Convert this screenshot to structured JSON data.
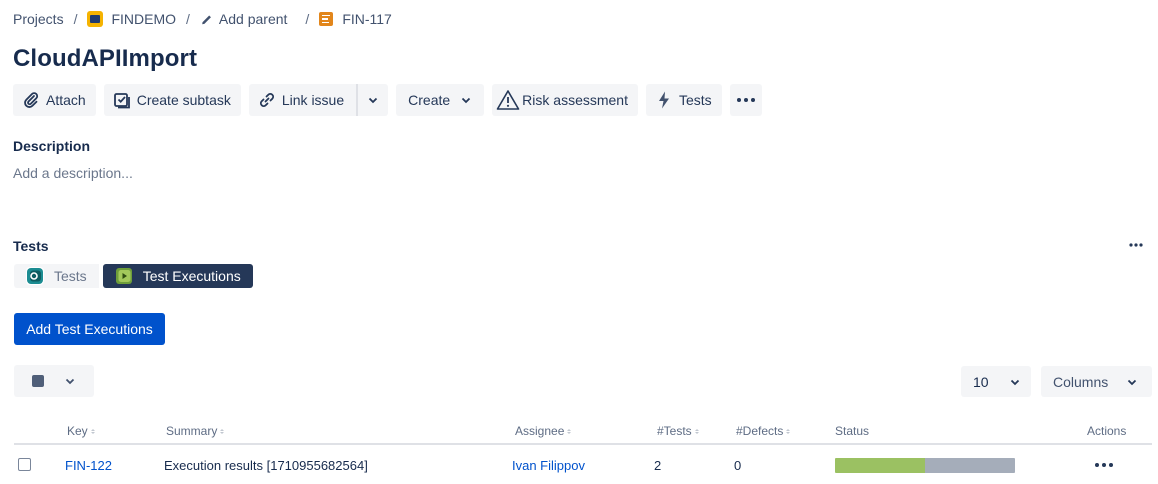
{
  "breadcrumb": {
    "projects": "Projects",
    "project": "FINDEMO",
    "add_parent": "Add parent",
    "issue_key": "FIN-117"
  },
  "issue": {
    "title": "CloudAPIImport"
  },
  "toolbar": {
    "attach": "Attach",
    "create_subtask": "Create subtask",
    "link_issue": "Link issue",
    "create": "Create",
    "risk_assessment": "Risk assessment",
    "tests": "Tests"
  },
  "description": {
    "label": "Description",
    "placeholder": "Add a description..."
  },
  "tests_panel": {
    "label": "Tests",
    "tabs": [
      {
        "label": "Tests",
        "active": false
      },
      {
        "label": "Test Executions",
        "active": true
      }
    ],
    "add_button": "Add Test Executions",
    "page_size": "10",
    "columns_button": "Columns",
    "table": {
      "headers": {
        "key": "Key",
        "summary": "Summary",
        "assignee": "Assignee",
        "tests": "#Tests",
        "defects": "#Defects",
        "status": "Status",
        "actions": "Actions"
      },
      "rows": [
        {
          "key": "FIN-122",
          "summary": "Execution results [1710955682564]",
          "assignee": "Ivan Filippov",
          "tests": "2",
          "defects": "0",
          "status_pass_fraction": 0.5
        }
      ]
    }
  },
  "colors": {
    "primary": "#0052cc",
    "pass": "#9bc162",
    "todo": "#a5adba",
    "active_tab": "#253858"
  }
}
